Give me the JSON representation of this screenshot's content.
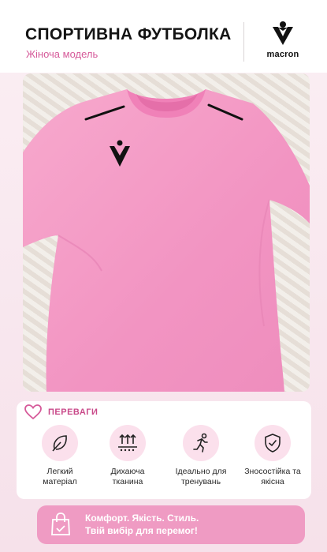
{
  "header": {
    "title": "СПОРТИВНА ФУТБОЛКА",
    "subtitle": "Жіноча модель",
    "brand": "macron"
  },
  "product_image": {
    "icon": "pink-tshirt-photo"
  },
  "advantages": {
    "title": "ПЕРЕВАГИ",
    "items": [
      {
        "label": "Легкий\nматеріал",
        "icon": "leaf-icon"
      },
      {
        "label": "Дихаюча\nтканина",
        "icon": "airflow-icon"
      },
      {
        "label": "Ідеально для\nтренувань",
        "icon": "running-icon"
      },
      {
        "label": "Зносостійка та\nякісна",
        "icon": "shield-check-icon"
      }
    ]
  },
  "banner": {
    "text": "Комфорт. Якість. Стиль.\nТвій вибір для перемог!",
    "icon": "shopping-bag-icon"
  },
  "colors": {
    "accent": "#d65b9a",
    "shirt": "#f49cc6",
    "banner": "#ef9bc3",
    "icon_bg": "#fbe0ec"
  }
}
